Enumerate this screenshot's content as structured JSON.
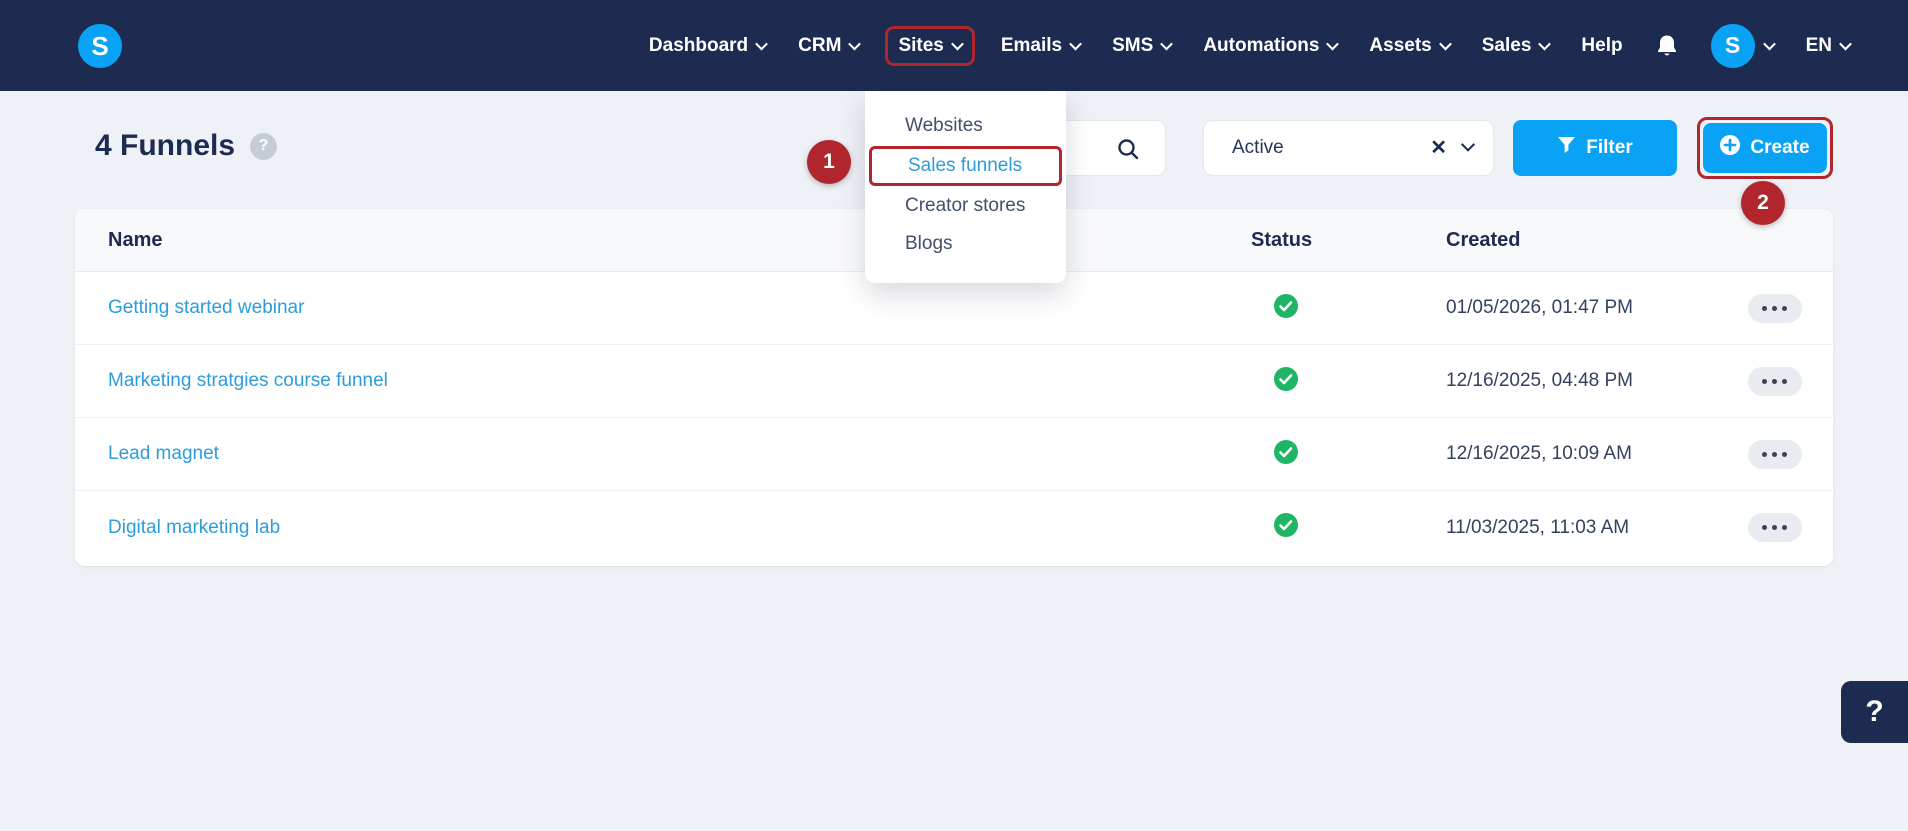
{
  "nav": {
    "logo_letter": "S",
    "items": [
      {
        "label": "Dashboard",
        "has_chevron": true
      },
      {
        "label": "CRM",
        "has_chevron": true
      },
      {
        "label": "Sites",
        "has_chevron": true,
        "highlighted": true
      },
      {
        "label": "Emails",
        "has_chevron": true
      },
      {
        "label": "SMS",
        "has_chevron": true
      },
      {
        "label": "Automations",
        "has_chevron": true
      },
      {
        "label": "Assets",
        "has_chevron": true
      },
      {
        "label": "Sales",
        "has_chevron": true
      },
      {
        "label": "Help",
        "has_chevron": false
      }
    ],
    "avatar_letter": "S",
    "language": "EN"
  },
  "sites_menu": {
    "items": [
      {
        "label": "Websites",
        "active": false
      },
      {
        "label": "Sales funnels",
        "active": true
      },
      {
        "label": "Creator stores",
        "active": false
      },
      {
        "label": "Blogs",
        "active": false
      }
    ]
  },
  "page": {
    "title": "4 Funnels",
    "help_badge": "?"
  },
  "controls": {
    "search": {
      "value": ""
    },
    "status_filter": {
      "value": "Active",
      "clear_glyph": "✕"
    },
    "filter_button": {
      "label": "Filter"
    },
    "create_button": {
      "label": "Create"
    }
  },
  "table": {
    "columns": [
      "Name",
      "Status",
      "Created"
    ],
    "rows": [
      {
        "name": "Getting started webinar",
        "status": "active",
        "created": "01/05/2026, 01:47 PM"
      },
      {
        "name": "Marketing stratgies course funnel",
        "status": "active",
        "created": "12/16/2025, 04:48 PM"
      },
      {
        "name": "Lead magnet",
        "status": "active",
        "created": "12/16/2025, 10:09 AM"
      },
      {
        "name": "Digital marketing lab",
        "status": "active",
        "created": "11/03/2025, 11:03 AM"
      }
    ]
  },
  "annotations": {
    "step1": "1",
    "step2": "2"
  },
  "help_widget": {
    "label": "?"
  },
  "colors": {
    "navbar": "#1d2b50",
    "accent_blue": "#0aa2f5",
    "link_blue": "#2d9cdb",
    "success_green": "#1eb564",
    "annotation_red": "#b0262c"
  }
}
